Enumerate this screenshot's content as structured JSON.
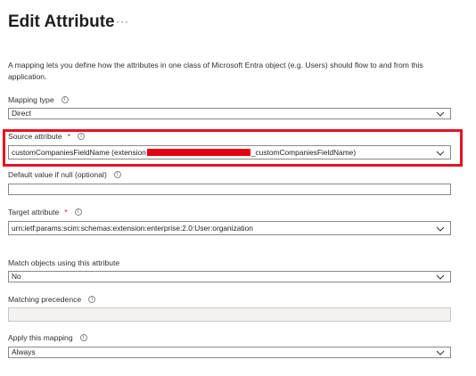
{
  "header": {
    "title": "Edit Attribute",
    "more_label": "···"
  },
  "description": "A mapping lets you define how the attributes in one class of Microsoft Entra object (e.g. Users) should flow to and from this application.",
  "fields": {
    "mapping_type": {
      "label": "Mapping type",
      "value": "Direct"
    },
    "source_attribute": {
      "label": "Source attribute",
      "required_mark": "*",
      "value_prefix": "customCompaniesFieldName (extension",
      "value_suffix": "_customCompaniesFieldName)"
    },
    "default_value": {
      "label": "Default value if null (optional)",
      "value": ""
    },
    "target_attribute": {
      "label": "Target attribute",
      "required_mark": "*",
      "value": "urn:ietf:params:scim:schemas:extension:enterprise:2.0:User:organization"
    },
    "match_objects": {
      "label": "Match objects using this attribute",
      "value": "No"
    },
    "matching_precedence": {
      "label": "Matching precedence",
      "value": ""
    },
    "apply_mapping": {
      "label": "Apply this mapping",
      "value": "Always"
    }
  },
  "icons": {
    "info": "info-icon",
    "dropdown": "chevron-down-icon"
  },
  "colors": {
    "highlight": "#e81123",
    "redaction": "#e60012",
    "required": "#a4262c"
  }
}
